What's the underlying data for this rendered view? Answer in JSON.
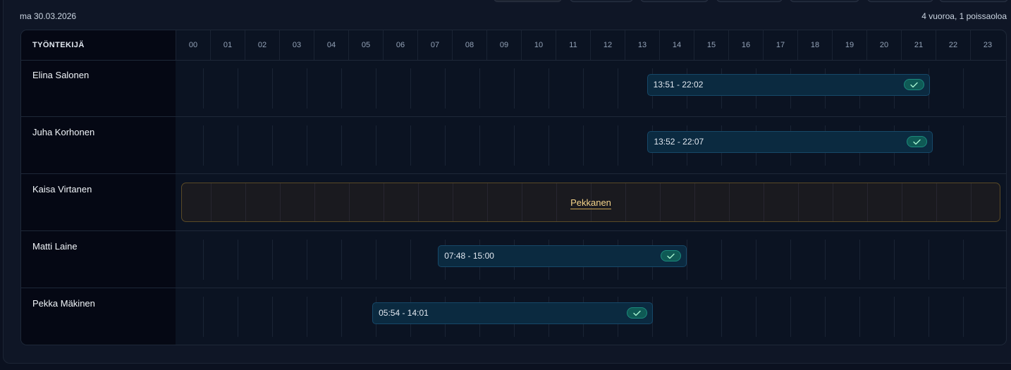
{
  "header": {
    "date": "ma 30.03.2026",
    "summary": "4 vuoroa, 1 poissaoloa"
  },
  "table": {
    "name_column_title": "TYÖNTEKIJÄ",
    "hours": [
      "00",
      "01",
      "02",
      "03",
      "04",
      "05",
      "06",
      "07",
      "08",
      "09",
      "10",
      "11",
      "12",
      "13",
      "14",
      "15",
      "16",
      "17",
      "18",
      "19",
      "20",
      "21",
      "22",
      "23"
    ]
  },
  "employees": [
    {
      "name": "Elina Salonen",
      "shift": {
        "label": "13:51 - 22:02",
        "start": "13:51",
        "end": "22:02",
        "confirmed": true
      }
    },
    {
      "name": "Juha Korhonen",
      "shift": {
        "label": "13:52 - 22:07",
        "start": "13:52",
        "end": "22:07",
        "confirmed": true
      }
    },
    {
      "name": "Kaisa Virtanen",
      "absence": {
        "label": "Pekkanen"
      }
    },
    {
      "name": "Matti Laine",
      "shift": {
        "label": "07:48 - 15:00",
        "start": "07:48",
        "end": "15:00",
        "confirmed": true
      }
    },
    {
      "name": "Pekka Mäkinen",
      "shift": {
        "label": "05:54 - 14:01",
        "start": "05:54",
        "end": "14:01",
        "confirmed": true
      }
    }
  ],
  "colors": {
    "shift_bg": "#0b2a40",
    "shift_border": "#164868",
    "confirmed_badge": "#0f5a55",
    "absence_border": "#5a4a26",
    "absence_text": "#f5d48a"
  },
  "icons": {
    "confirmed": "check-icon"
  }
}
